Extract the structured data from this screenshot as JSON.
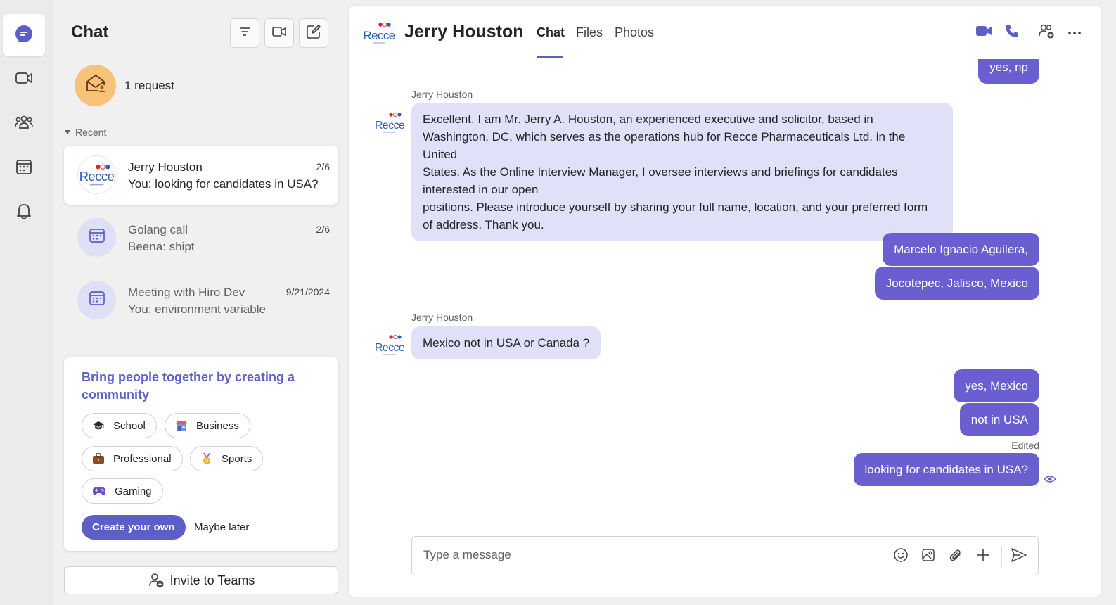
{
  "rail": {
    "items": [
      {
        "name": "chat",
        "icon": "chat-icon",
        "active": true
      },
      {
        "name": "meet",
        "icon": "video-icon"
      },
      {
        "name": "communities",
        "icon": "people-icon"
      },
      {
        "name": "calendar",
        "icon": "calendar-icon"
      },
      {
        "name": "activity",
        "icon": "bell-icon"
      }
    ]
  },
  "list": {
    "title": "Chat",
    "tools": [
      "filter-icon",
      "meet-now-icon",
      "new-chat-icon"
    ],
    "request_label": "1 request",
    "recent_label": "Recent",
    "chats": [
      {
        "name": "Jerry Houston",
        "preview": "You: looking for candidates in USA?",
        "date": "2/6"
      },
      {
        "name": "Golang call",
        "preview": "Beena: shipt",
        "date": "2/6"
      },
      {
        "name": "Meeting with Hiro Dev",
        "preview": "You: environment variable",
        "date": "9/21/2024"
      }
    ]
  },
  "community": {
    "title": "Bring people together by creating a community",
    "chips": [
      "School",
      "Business",
      "Professional",
      "Sports",
      "Gaming"
    ],
    "create_label": "Create your own",
    "later_label": "Maybe later"
  },
  "invite_label": "Invite to Teams",
  "main": {
    "contact_name": "Jerry Houston",
    "logo_text": "Recce",
    "tabs": [
      "Chat",
      "Files",
      "Photos"
    ],
    "active_tab": "Chat",
    "messages": {
      "prev_out": "yes, np",
      "sender1": "Jerry Houston",
      "in1_lines": [
        "Excellent. I am Mr. Jerry A. Houston, an experienced executive and solicitor, based in",
        "Washington, DC, which serves as the operations hub for Recce Pharmaceuticals Ltd. in the United",
        "States. As the Online Interview Manager, I oversee interviews and briefings for candidates",
        "interested in our open",
        "positions. Please introduce yourself by sharing your full name, location, and your preferred form",
        "of address. Thank you."
      ],
      "out1": "Marcelo Ignacio Aguilera,",
      "out2": "Jocotepec, Jalisco, Mexico",
      "sender2": "Jerry Houston",
      "in2": "Mexico not in USA or Canada ?",
      "out3": "yes, Mexico",
      "out4": "not in USA",
      "edited_label": "Edited",
      "out5": "looking for candidates in USA?"
    },
    "composer_placeholder": "Type a message"
  },
  "colors": {
    "accent": "#5b5fc7",
    "bubble_out": "#6a5fd0",
    "bubble_in": "#e0e1f8"
  }
}
